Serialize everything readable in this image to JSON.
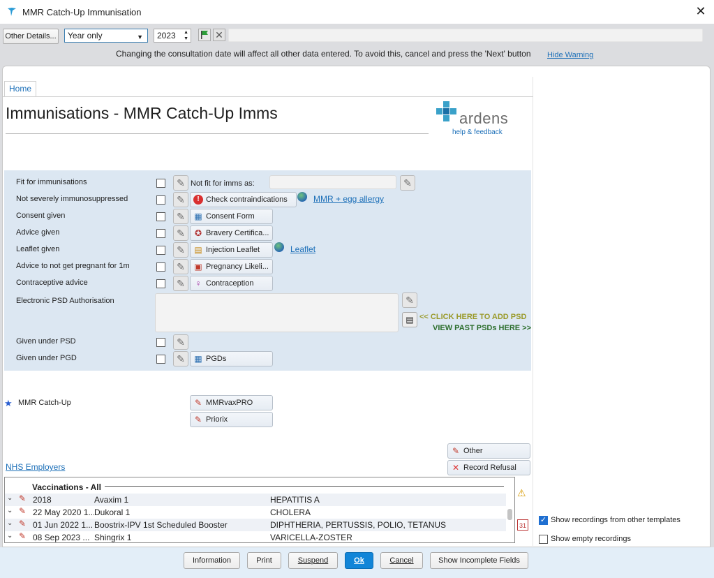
{
  "window": {
    "title": "MMR Catch-Up Immunisation",
    "close_glyph": "✕"
  },
  "toolbar": {
    "other_details": "Other Details...",
    "date_precision": "Year only",
    "year": "2023",
    "warning": "Changing the consultation date will affect all other data entered. To avoid this, cancel and press the 'Next' button",
    "hide_warning": "Hide Warning"
  },
  "tabs": {
    "home": "Home"
  },
  "page": {
    "title": "Immunisations - MMR Catch-Up Imms"
  },
  "logo": {
    "word": "ardens",
    "help": "help & feedback"
  },
  "form": {
    "rows": [
      {
        "label": "Fit for immunisations"
      },
      {
        "label": "Not severely immunosuppressed"
      },
      {
        "label": "Consent given"
      },
      {
        "label": "Advice given"
      },
      {
        "label": "Leaflet given"
      },
      {
        "label": "Advice to not get pregnant for 1m"
      },
      {
        "label": "Contraceptive advice"
      },
      {
        "label": "Electronic PSD Authorisation"
      },
      {
        "label": "Given under PSD"
      },
      {
        "label": "Given under PGD"
      }
    ],
    "not_fit_label": "Not fit for imms as:",
    "buttons": {
      "check_contra": "Check contraindications",
      "consent_form": "Consent Form",
      "bravery": "Bravery Certifica...",
      "injection_leaflet": "Injection Leaflet",
      "pregnancy": "Pregnancy Likeli...",
      "contraception": "Contraception",
      "pgds": "PGDs"
    },
    "links": {
      "mmr_egg": "MMR + egg allergy",
      "leaflet": "Leaflet"
    },
    "psd_add": "<< CLICK HERE TO ADD PSD",
    "psd_past": "VIEW PAST PSDs HERE >>"
  },
  "catchup": {
    "label": "MMR Catch-Up",
    "products": [
      "MMRvaxPRO",
      "Priorix"
    ],
    "other": "Other",
    "refusal": "Record Refusal"
  },
  "nhs_link": "NHS Employers",
  "vaccinations": {
    "header": "Vaccinations - All",
    "rows": [
      {
        "date": "2018",
        "vaccine": "Avaxim 1",
        "disease": "HEPATITIS A"
      },
      {
        "date": "22 May 2020 1...",
        "vaccine": "Dukoral 1",
        "disease": "CHOLERA"
      },
      {
        "date": "01 Jun 2022 1...",
        "vaccine": "Boostrix-IPV 1st Scheduled Booster",
        "disease": "DIPHTHERIA, PERTUSSIS, POLIO, TETANUS"
      },
      {
        "date": "08 Sep 2023 ...",
        "vaccine": "Shingrix 1",
        "disease": "VARICELLA-ZOSTER"
      }
    ]
  },
  "options": {
    "show_other": "Show recordings from other templates",
    "show_empty": "Show empty recordings",
    "calendar_day": "31"
  },
  "footer": {
    "information": "Information",
    "print": "Print",
    "suspend": "Suspend",
    "ok": "Ok",
    "cancel": "Cancel",
    "show_incomplete": "Show Incomplete Fields"
  },
  "colors": {
    "accent": "#1185d8",
    "link": "#1c6fb8",
    "section_bg": "#dce7f2",
    "psd_add": "#9a9a2a",
    "psd_past": "#2c6e2c"
  }
}
